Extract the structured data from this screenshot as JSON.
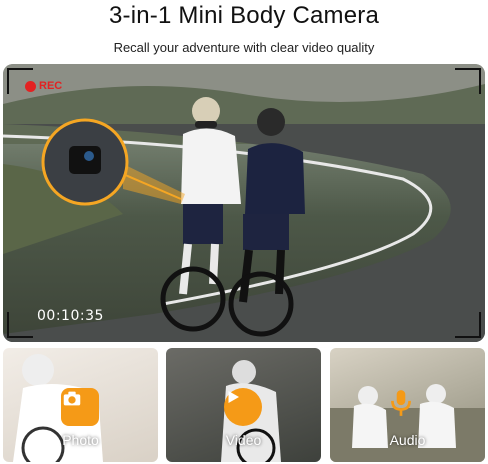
{
  "header": {
    "title": "3-in-1 Mini Body Camera",
    "subtitle": "Recall your adventure with clear video quality"
  },
  "hero": {
    "rec_label": "REC",
    "timestamp": "00:10:35"
  },
  "modes": [
    {
      "label": "Photo",
      "icon": "camera-icon"
    },
    {
      "label": "Video",
      "icon": "play-icon"
    },
    {
      "label": "Audio",
      "icon": "microphone-icon"
    }
  ],
  "colors": {
    "accent": "#f59a17",
    "rec": "#e32222"
  }
}
